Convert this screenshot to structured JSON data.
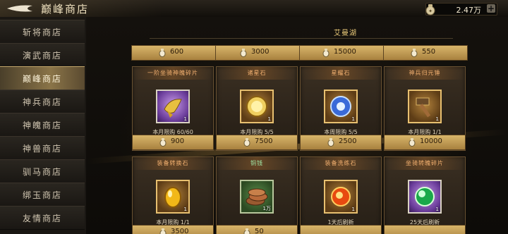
{
  "header": {
    "title": "巅峰商店",
    "currency": {
      "icon": "coin-bag-icon",
      "value": "2.47万",
      "add_label": "+"
    }
  },
  "sidebar": {
    "items": [
      {
        "label": "斩将商店",
        "active": false
      },
      {
        "label": "演武商店",
        "active": false
      },
      {
        "label": "巅峰商店",
        "active": true
      },
      {
        "label": "神兵商店",
        "active": false
      },
      {
        "label": "神魄商店",
        "active": false
      },
      {
        "label": "神兽商店",
        "active": false
      },
      {
        "label": "驯马商店",
        "active": false
      },
      {
        "label": "绑玉商店",
        "active": false
      },
      {
        "label": "友情商店",
        "active": false
      }
    ]
  },
  "main": {
    "merchant_label": "艾曼湖",
    "top_prices": [
      "600",
      "3000",
      "15000",
      "550"
    ],
    "cards": [
      {
        "title": "一阶坐骑神魄碎片",
        "title_color": "#f2b070",
        "icon": "gold-shard-icon",
        "frame": "purple",
        "count": "1",
        "limit": "本月限购 60/60",
        "price": "900"
      },
      {
        "title": "诸星石",
        "title_color": "#f2b070",
        "icon": "star-stone-icon",
        "frame": "gold",
        "count": "1",
        "limit": "本月限购 5/5",
        "price": "7500"
      },
      {
        "title": "星耀石",
        "title_color": "#f2b070",
        "icon": "star-orb-icon",
        "frame": "gold",
        "count": "1",
        "limit": "本周限购 5/5",
        "price": "2500"
      },
      {
        "title": "神兵归元锤",
        "title_color": "#f2b070",
        "icon": "hammer-icon",
        "frame": "gold",
        "count": "1",
        "limit": "本月限购 1/1",
        "price": "10000"
      },
      {
        "title": "装备转换石",
        "title_color": "#f2b070",
        "icon": "yellow-gem-icon",
        "frame": "gold",
        "count": "1",
        "limit": "本月限购 1/1",
        "price": "3500"
      },
      {
        "title": "铜钱",
        "title_color": "#9fe6a6",
        "icon": "copper-coins-icon",
        "frame": "green",
        "count": "1万",
        "limit": "",
        "price": "50"
      },
      {
        "title": "装备洗练石",
        "title_color": "#f2b070",
        "icon": "fire-orb-icon",
        "frame": "gold",
        "count": "1",
        "limit": "1天后刷新",
        "price": ""
      },
      {
        "title": "坐骑转魄碎片",
        "title_color": "#f2b070",
        "icon": "green-orb-icon",
        "frame": "purple",
        "count": "1",
        "limit": "25天后刷新",
        "price": ""
      }
    ]
  }
}
